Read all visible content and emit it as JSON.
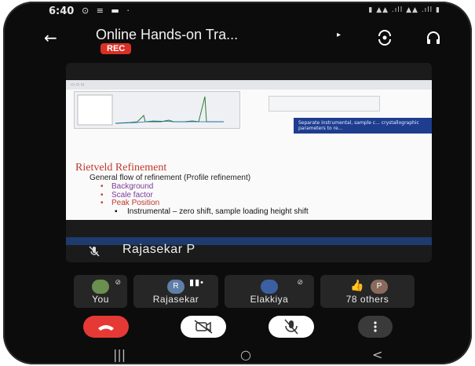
{
  "status_bar": {
    "time": "6:40"
  },
  "header": {
    "title": "Online Hands-on Tra...",
    "rec_badge": "REC"
  },
  "shared_screen": {
    "slide_title": "Rietveld Refinement",
    "subtitle": "General flow of refinement (Profile refinement)",
    "bullets": [
      {
        "text": "Background",
        "color": "#7d3c98"
      },
      {
        "text": "Scale factor",
        "color": "#7d3c98"
      },
      {
        "text": "Peak Position",
        "color": "#c0392b"
      }
    ],
    "sub_bullet": "Instrumental – zero shift, sample loading height shift",
    "blue_box_text": "Separate instrumental, sample c... crystallographic parameters to re..."
  },
  "main_speaker": {
    "name": "Rajasekar P"
  },
  "participants": [
    {
      "label": "You",
      "avatar": "photo",
      "avatar_color": "#6b8f4e",
      "muted": true
    },
    {
      "label": "Rajasekar",
      "avatar": "R",
      "avatar_color": "#5f7fa8",
      "speaking": true
    },
    {
      "label": "Elakkiya",
      "avatar": "photo",
      "avatar_color": "#3b5fa0",
      "muted": true
    },
    {
      "label": "78 others",
      "avatar": "P",
      "avatar_color": "#8a6a5c"
    }
  ],
  "controls": {
    "end_call_color": "#e53935",
    "camera_off_color": "#ffffff",
    "mic_off_color": "#ffffff",
    "more_color": "#3a3a3a"
  },
  "nav": {
    "recents": "|||",
    "home": "○",
    "back": "<"
  }
}
